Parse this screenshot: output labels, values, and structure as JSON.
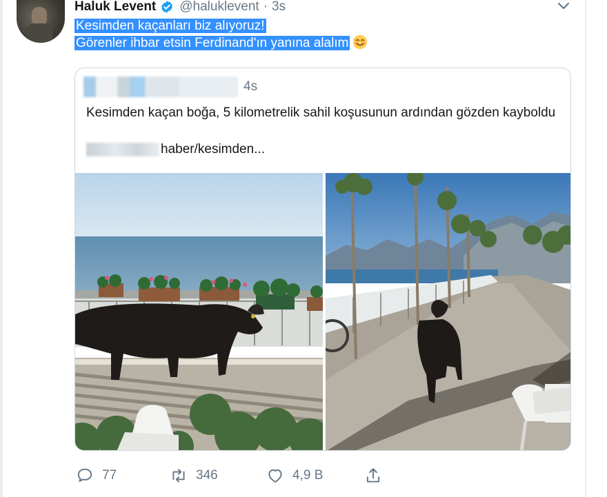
{
  "tweet": {
    "display_name": "Haluk Levent",
    "handle": "@haluklevent",
    "separator": "·",
    "time": "3s",
    "text_line_1": "Kesimden kaçanları biz alıyoruz!",
    "text_line_2": "Görenler ihbar etsin Ferdinand'ın yanına alalım",
    "emoji": "smiling-face-icon"
  },
  "quote": {
    "time": "4s",
    "text": "Kesimden kaçan boğa, 5 kilometrelik sahil koşusunun ardından gözden kayboldu",
    "link_suffix": "haber/kesimden..."
  },
  "actions": {
    "reply_count": "77",
    "retweet_count": "346",
    "like_count": "4,9 B"
  },
  "colors": {
    "selection": "#3390ff",
    "muted": "#657786",
    "verified": "#1da1f2"
  }
}
